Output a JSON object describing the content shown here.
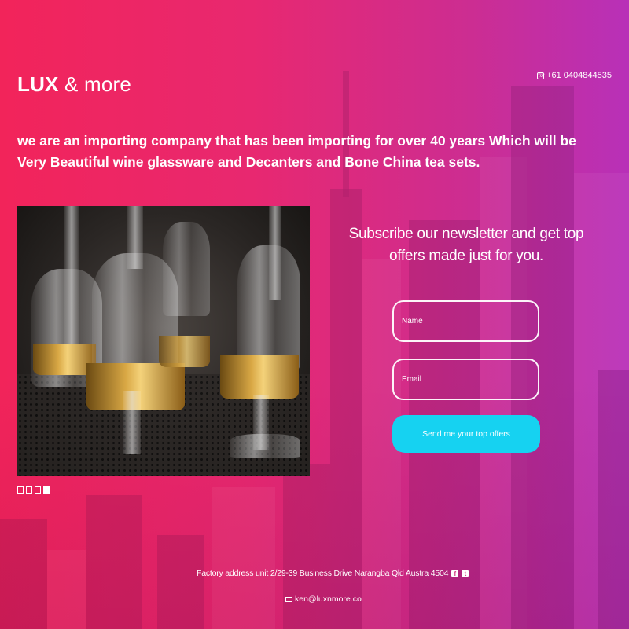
{
  "brand": {
    "name_bold": "LUX",
    "name_rest": "& more"
  },
  "header": {
    "phone": "+61 0404844535",
    "phone_icon": "phone-icon"
  },
  "intro": {
    "text": "we are an importing company that has been importing for over 40 years Which will be Very Beautiful wine glassware and Decanters and Bone China tea sets."
  },
  "carousel": {
    "slide_count": 4,
    "active_index": 3
  },
  "newsletter": {
    "title": "Subscribe our newsletter and get top offers made just for you.",
    "name_placeholder": "Name",
    "email_placeholder": "Email",
    "submit_label": "Send me your top offers"
  },
  "footer": {
    "address": "Factory address unit 2/29-39 Business Drive Narangba Qld Austra 4504",
    "email": "ken@luxnmore.co",
    "icons": [
      "facebook-icon",
      "twitter-icon",
      "mail-icon"
    ]
  },
  "colors": {
    "gradient_start": "#f2245a",
    "gradient_end": "#b830b8",
    "button": "#16d2f1",
    "text": "#ffffff"
  }
}
